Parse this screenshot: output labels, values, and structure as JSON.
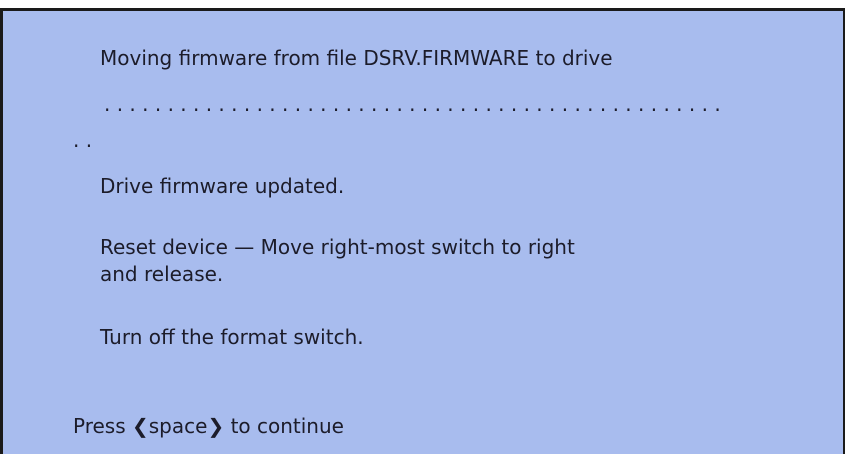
{
  "console": {
    "line1": "Moving firmware from file DSRV.FIRMWARE to drive",
    "progress_dots": ". . . . . . . . . . . . . . . . . . . . . . . . . . . . . . . . . . . . . . . . . . . . . . . . .",
    "progress_dots_wrap": ". .",
    "status": "Drive firmware updated.",
    "instruction_reset_1": "Reset device — Move right-most switch to right",
    "instruction_reset_2": "and release.",
    "instruction_format": "Turn off the format switch."
  },
  "prompt": {
    "prefix": "Press",
    "key_open": "❮",
    "key_label": "space",
    "key_close": "❯",
    "suffix": "to continue"
  }
}
